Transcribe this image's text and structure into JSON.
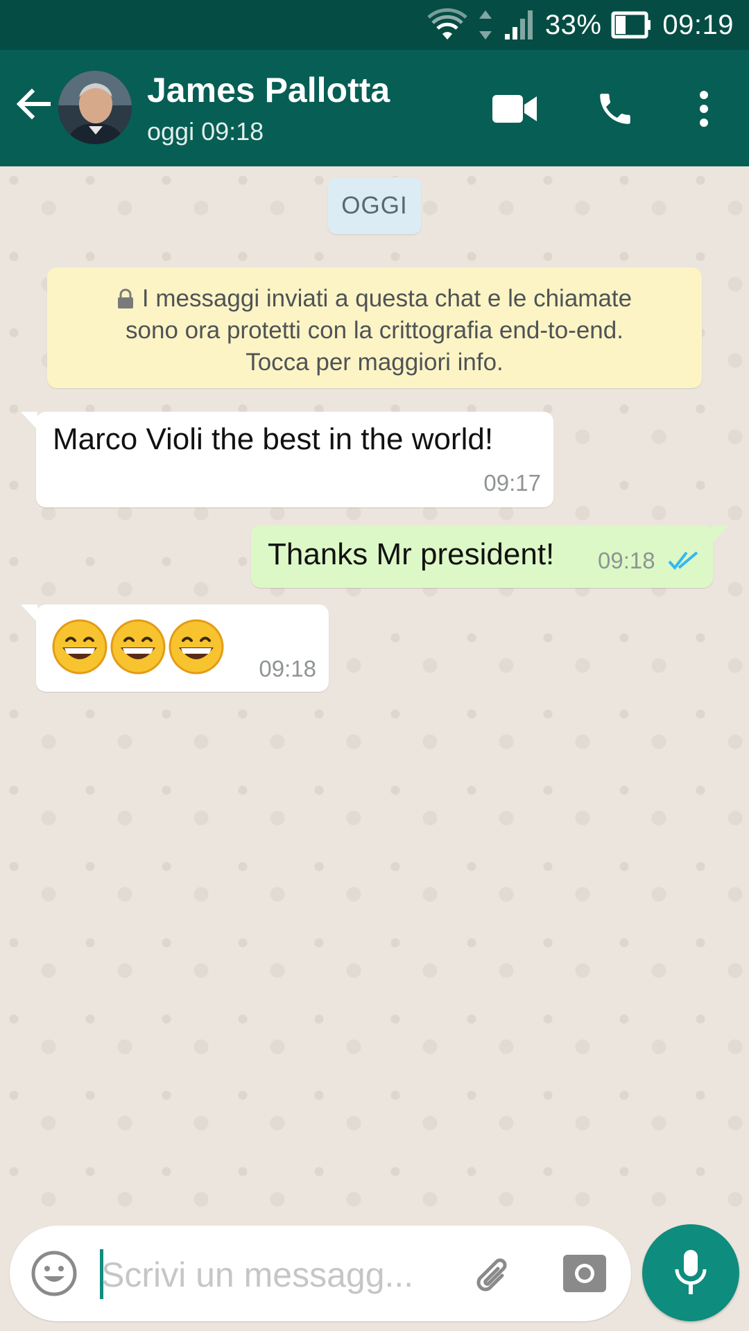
{
  "status_bar": {
    "battery": "33%",
    "time": "09:19",
    "icons": [
      "wifi-icon",
      "data-arrows-icon",
      "signal-icon",
      "battery-icon"
    ]
  },
  "header": {
    "contact_name": "James Pallotta",
    "last_seen": "oggi 09:18",
    "icons": [
      "back-arrow-icon",
      "video-call-icon",
      "voice-call-icon",
      "more-vert-icon"
    ]
  },
  "chat": {
    "date_chip": "OGGI",
    "encryption_notice": {
      "lines": [
        "I messaggi inviati a questa chat e le chiamate",
        "sono ora protetti con la crittografia end-to-end.",
        "Tocca per maggiori info."
      ]
    },
    "messages": [
      {
        "direction": "incoming",
        "text": "Marco Violi the best in the world!",
        "time": "09:17"
      },
      {
        "direction": "outgoing",
        "text": "Thanks Mr president!",
        "time": "09:18",
        "status": "read"
      },
      {
        "direction": "incoming",
        "emoji": [
          "grinning-face",
          "grinning-face",
          "grinning-face"
        ],
        "time": "09:18"
      }
    ]
  },
  "composer": {
    "placeholder": "Scrivi un messagg...",
    "value": "",
    "icons": [
      "emoji-icon",
      "attach-icon",
      "camera-icon",
      "mic-icon"
    ]
  },
  "colors": {
    "status_bar": "#054d44",
    "app_bar": "#075e54",
    "outgoing_bubble": "#dcf8c6",
    "incoming_bubble": "#ffffff",
    "notice_bg": "#fdf4c5",
    "date_chip_bg": "#dcecf5",
    "accent": "#0e8c7d",
    "read_ticks": "#34b7f1"
  }
}
